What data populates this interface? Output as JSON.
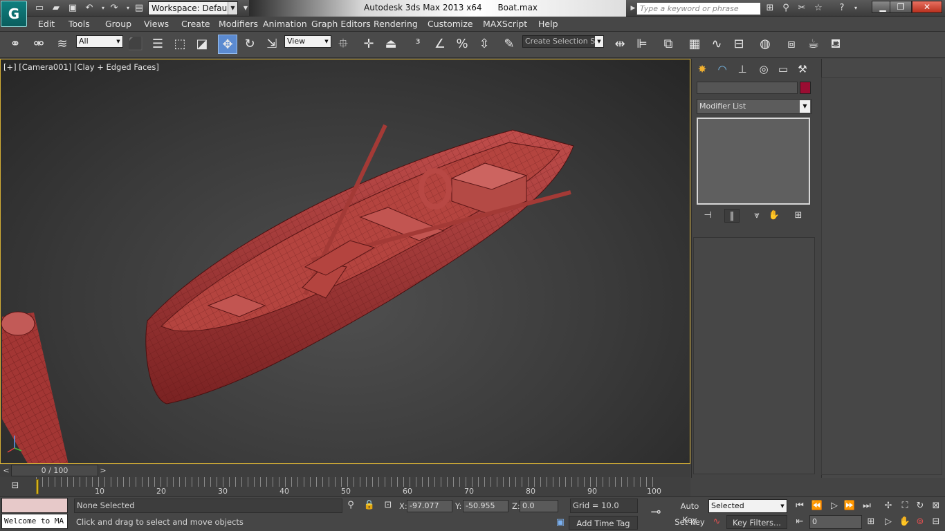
{
  "titlebar": {
    "workspace_label": "Workspace: Default",
    "app_title": "Autodesk 3ds Max  2013 x64",
    "file_name": "Boat.max",
    "search_placeholder": "Type a keyword or phrase"
  },
  "menu": [
    "Edit",
    "Tools",
    "Group",
    "Views",
    "Create",
    "Modifiers",
    "Animation",
    "Graph Editors",
    "Rendering",
    "Customize",
    "MAXScript",
    "Help"
  ],
  "toolbar": {
    "selection_filter": "All",
    "reference_coord": "View",
    "named_selection_set": "Create Selection Se"
  },
  "viewport": {
    "label": "[+] [Camera001] [Clay + Edged Faces]",
    "model_color": "#a63a38"
  },
  "command_panel": {
    "modifier_list": "Modifier List",
    "object_color": "#9a0d32"
  },
  "timeline": {
    "frame_display": "0 / 100",
    "ticks": [
      "10",
      "20",
      "30",
      "40",
      "50",
      "60",
      "70",
      "80",
      "90",
      "100"
    ]
  },
  "status": {
    "welcome": "Welcome to MA",
    "selection": "None Selected",
    "prompt": "Click and drag to select and move objects",
    "x_label": "X:",
    "x_value": "-97.077",
    "y_label": "Y:",
    "y_value": "-50.955",
    "z_label": "Z:",
    "z_value": "0.0",
    "grid": "Grid = 10.0",
    "add_time_tag": "Add Time Tag",
    "auto_key": "Auto Key",
    "set_key": "Set Key",
    "key_mode": "Selected",
    "key_filters": "Key Filters...",
    "current_frame": "0"
  }
}
